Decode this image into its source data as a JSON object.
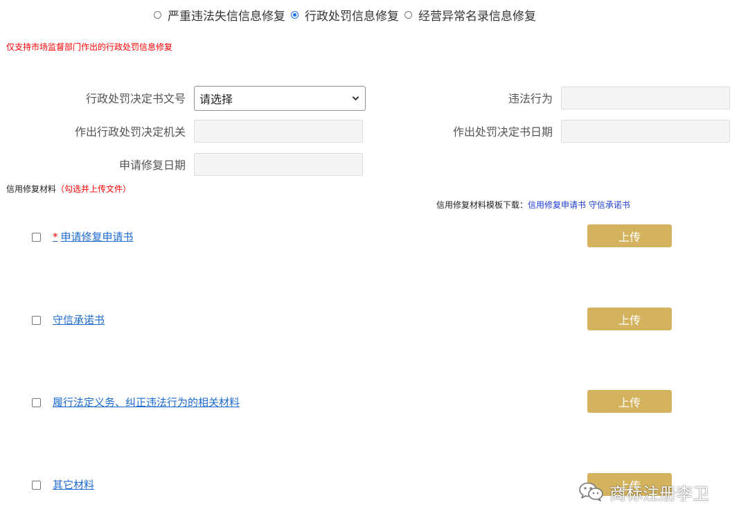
{
  "repair_type": {
    "options": [
      {
        "label": "严重违法失信信息修复",
        "checked": false
      },
      {
        "label": "行政处罚信息修复",
        "checked": true
      },
      {
        "label": "经营异常名录信息修复",
        "checked": false
      }
    ]
  },
  "notice": "仅支持市场监督部门作出的行政处罚信息修复",
  "form": {
    "decision_no_label": "行政处罚决定书文号",
    "decision_no_value": "请选择",
    "illegal_act_label": "违法行为",
    "illegal_act_value": "",
    "authority_label": "作出行政处罚决定机关",
    "authority_value": "",
    "decision_date_label": "作出处罚决定书日期",
    "decision_date_value": "",
    "apply_date_label": "申请修复日期",
    "apply_date_value": ""
  },
  "materials_section": {
    "title": "信用修复材料",
    "hint": "（勾选并上传文件）"
  },
  "template_download": {
    "label": "信用修复材料模板下载：",
    "links": [
      "信用修复申请书",
      "守信承诺书"
    ]
  },
  "materials": [
    {
      "required_mark": "*",
      "label": "申请修复申请书",
      "checked": false,
      "upload_label": "上传"
    },
    {
      "required_mark": "",
      "label": "守信承诺书",
      "checked": false,
      "upload_label": "上传"
    },
    {
      "required_mark": "",
      "label": "履行法定义务、纠正违法行为的相关材料",
      "checked": false,
      "upload_label": "上传"
    },
    {
      "required_mark": "",
      "label": "其它材料",
      "checked": false,
      "upload_label": "上传"
    }
  ],
  "watermark": {
    "text": "商标注册李卫",
    "icon": "wechat-icon"
  },
  "colors": {
    "upload_button": "#d4b35f",
    "notice_red": "#ff0000",
    "link_blue": "#1e6bd0",
    "template_link_blue": "#1d3cd1",
    "radio_checked": "#1a73e8"
  }
}
